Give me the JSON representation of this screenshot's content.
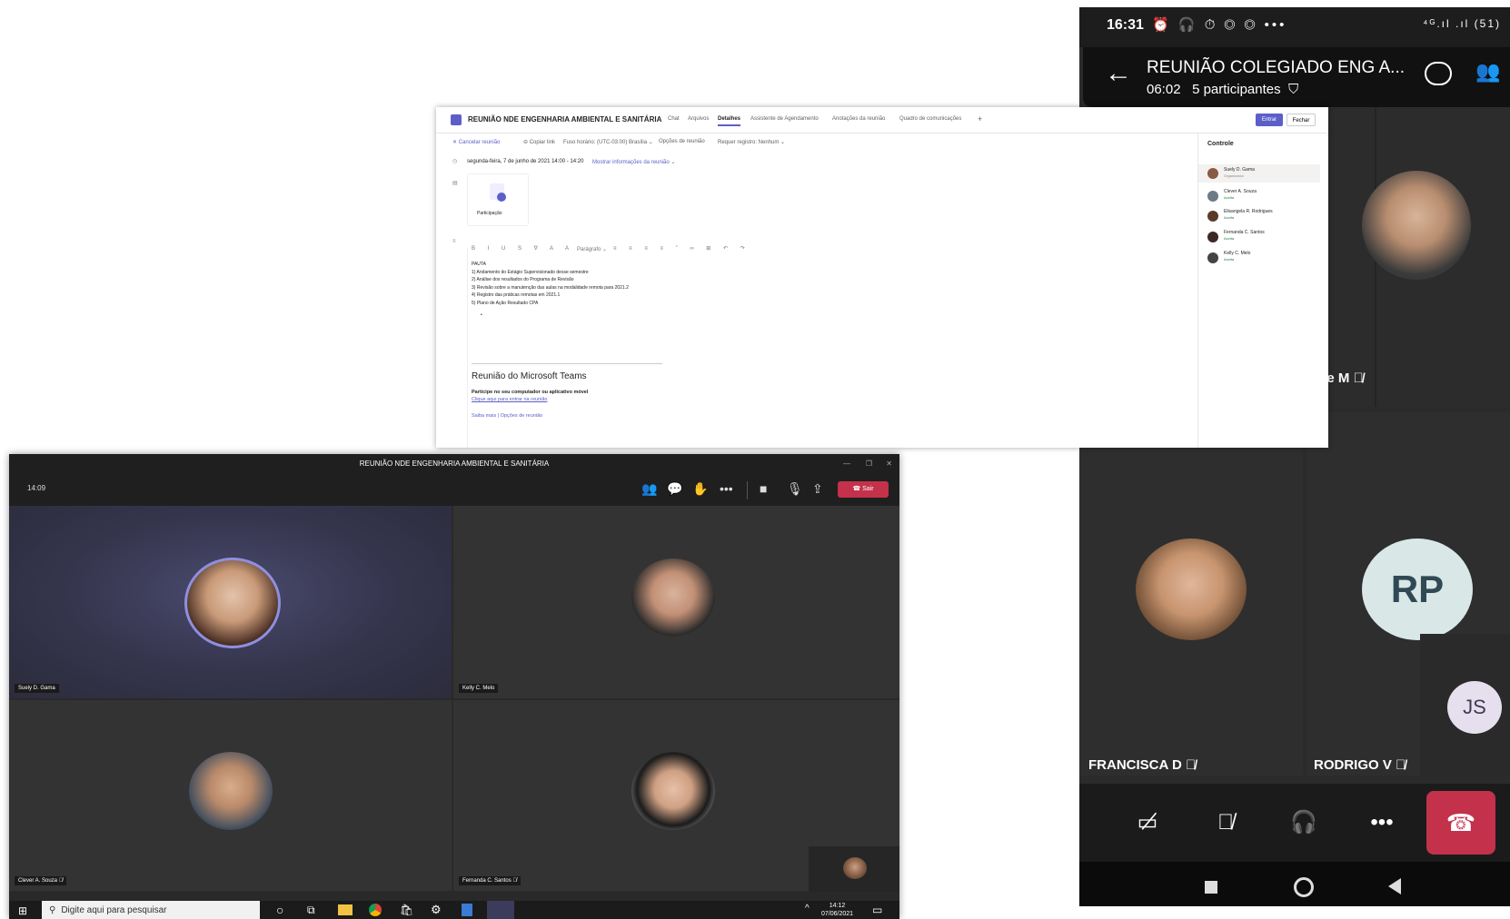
{
  "phone": {
    "status_time": "16:31",
    "status_icons": "⏰ 🎧 ⏱ ◎ ◎ •••",
    "status_right": "⁴ᴳ.ıl .ıl (51)",
    "header_title": "REUNIÃO COLEGIADO ENG A...",
    "header_duration": "06:02",
    "header_participants": "5 participantes",
    "participants": [
      {
        "label": "se M"
      },
      {
        "label": "FRANCISCA D"
      },
      {
        "label": "RODRIGO V",
        "initials": "RP"
      },
      {
        "initials": "JS"
      }
    ]
  },
  "details": {
    "meeting_title": "REUNIÃO NDE ENGENHARIA AMBIENTAL E SANITÁRIA",
    "tabs": [
      "Chat",
      "Arquivos",
      "Detalhes",
      "Assistente de Agendamento",
      "Anotações da reunião",
      "Quadro de comunicações",
      "+"
    ],
    "join_label": "Entrar",
    "close_label": "Fechar",
    "toolbar": {
      "cancel": "Cancelar reunião",
      "copy_link": "Copiar link",
      "timezone": "Fuso horário: (UTC-03:00) Brasília",
      "options": "Opções de reunião",
      "registration": "Requer registro: Nenhum"
    },
    "datetime": "segunda-feira, 7 de junho de 2021 14:00 - 14:20",
    "more_info": "Mostrar informações da reunião",
    "attendance_label": "Participação",
    "editor_format": "Parágrafo",
    "agenda": [
      "PAUTA",
      "1) Andamento do Estágio Supervisionado desse semestre",
      "2) Análise dos resultados do Programa de Revisão",
      "3) Revisão sobre a manutenção das aulas na modalidade remota para 2021.2",
      "4) Registro das práticas remotas em 2021.1",
      "5) Plano de Ação Resultado CPA"
    ],
    "teams_heading": "Reunião do Microsoft Teams",
    "teams_join_text": "Participe no seu computador ou aplicativo móvel",
    "teams_join_link": "Clique aqui para entrar na reunião",
    "learn_more": "Saiba mais",
    "meeting_options": "Opções de reunião",
    "side_title": "Controle",
    "side_people": [
      {
        "name": "Suely D. Gama",
        "role": "Organizador"
      },
      {
        "name": "Clever A. Souza",
        "role": "Aceita"
      },
      {
        "name": "Elisangela R. Rodrigues",
        "role": "Aceita"
      },
      {
        "name": "Fernanda C. Santos",
        "role": "Aceita"
      },
      {
        "name": "Kelly C. Melo",
        "role": "Aceita"
      }
    ]
  },
  "meeting": {
    "window_title": "REUNIÃO NDE ENGENHARIA AMBIENTAL E SANITÁRIA",
    "clock": "14:09",
    "leave_label": "Sair",
    "tiles": [
      {
        "name": "Suely D. Gama"
      },
      {
        "name": "Kelly C. Melo"
      },
      {
        "name": "Clever A. Souza"
      },
      {
        "name": "Fernanda C. Santos"
      }
    ],
    "taskbar": {
      "search_placeholder": "Digite aqui para pesquisar",
      "time": "14:12",
      "date": "07/06/2021"
    }
  },
  "colors": {
    "teams_purple": "#5b5fc7",
    "leave_red": "#c4314b",
    "tile_bg": "#2e2e2e"
  }
}
